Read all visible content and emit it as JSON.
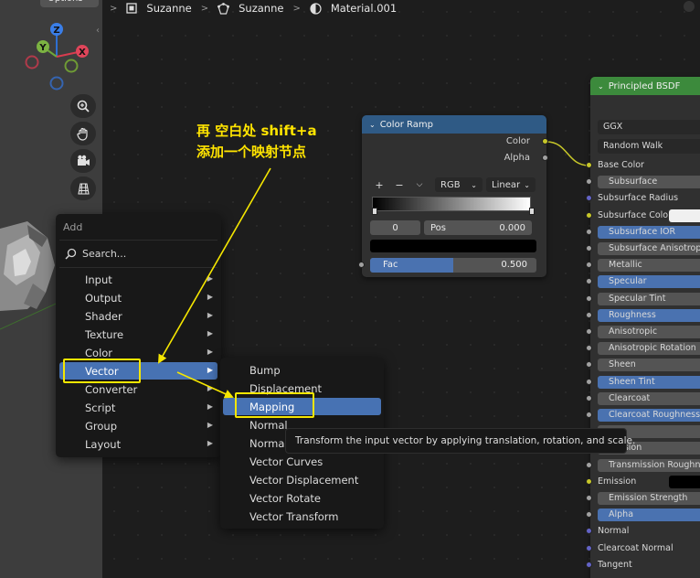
{
  "viewport": {
    "options_label": "Options",
    "gizmo_axes": [
      "Z",
      "Y",
      "X"
    ],
    "tools": [
      "zoom-icon",
      "hand-icon",
      "camera-icon",
      "grid-icon"
    ]
  },
  "breadcrumb": {
    "items": [
      {
        "label": "Suzanne",
        "icon": "object-icon"
      },
      {
        "label": "Suzanne",
        "icon": "mesh-icon"
      },
      {
        "label": "Material.001",
        "icon": "material-icon"
      }
    ]
  },
  "color_ramp": {
    "title": "Color Ramp",
    "outputs": [
      "Color",
      "Alpha"
    ],
    "tools": {
      "add": "+",
      "remove": "−",
      "more": "⌵"
    },
    "color_mode": "RGB",
    "interpolation": "Linear",
    "stop_index": "0",
    "pos_label": "Pos",
    "pos_value": "0.000",
    "fac_label": "Fac",
    "fac_value": "0.500",
    "fac_fraction": 0.5
  },
  "bsdf": {
    "title": "Principled BSDF",
    "distribution": "GGX",
    "subsurface_method": "Random Walk",
    "rows": [
      {
        "label": "Base Color",
        "kind": "socket",
        "socket": "#c7c729"
      },
      {
        "label": "Subsurface",
        "kind": "bar",
        "socket": "#a1a1a1"
      },
      {
        "label": "Subsurface Radius",
        "kind": "socket",
        "socket": "#6363c7"
      },
      {
        "label": "Subsurface Color",
        "kind": "socket-swatch",
        "socket": "#c7c729"
      },
      {
        "label": "Subsurface IOR",
        "kind": "bar-blue",
        "socket": "#a1a1a1"
      },
      {
        "label": "Subsurface Anisotropy",
        "kind": "bar",
        "socket": "#a1a1a1"
      },
      {
        "label": "Metallic",
        "kind": "bar",
        "socket": "#a1a1a1"
      },
      {
        "label": "Specular",
        "kind": "bar-blue",
        "socket": "#a1a1a1"
      },
      {
        "label": "Specular Tint",
        "kind": "bar",
        "socket": "#a1a1a1"
      },
      {
        "label": "Roughness",
        "kind": "bar-blue",
        "socket": "#a1a1a1"
      },
      {
        "label": "Anisotropic",
        "kind": "bar",
        "socket": "#a1a1a1"
      },
      {
        "label": "Anisotropic Rotation",
        "kind": "bar",
        "socket": "#a1a1a1"
      },
      {
        "label": "Sheen",
        "kind": "bar",
        "socket": "#a1a1a1"
      },
      {
        "label": "Sheen Tint",
        "kind": "bar-blue",
        "socket": "#a1a1a1"
      },
      {
        "label": "Clearcoat",
        "kind": "bar",
        "socket": "#a1a1a1"
      },
      {
        "label": "Clearcoat Roughness",
        "kind": "bar-blue",
        "socket": "#a1a1a1"
      },
      {
        "label": "",
        "kind": "bar",
        "socket": "#a1a1a1"
      },
      {
        "label": "mission",
        "kind": "bar",
        "socket": "#a1a1a1"
      },
      {
        "label": "Transmission Roughness",
        "kind": "bar",
        "socket": "#a1a1a1"
      },
      {
        "label": "Emission",
        "kind": "socket-swatch-black",
        "socket": "#c7c729"
      },
      {
        "label": "Emission Strength",
        "kind": "bar",
        "socket": "#a1a1a1"
      },
      {
        "label": "Alpha",
        "kind": "bar-blue",
        "socket": "#a1a1a1"
      },
      {
        "label": "Normal",
        "kind": "socket",
        "socket": "#6363c7"
      },
      {
        "label": "Clearcoat Normal",
        "kind": "socket",
        "socket": "#6363c7"
      },
      {
        "label": "Tangent",
        "kind": "socket",
        "socket": "#6363c7"
      }
    ]
  },
  "add_menu": {
    "title": "Add",
    "search_label": "Search...",
    "items": [
      {
        "label": "Input",
        "active": false
      },
      {
        "label": "Output",
        "active": false
      },
      {
        "label": "Shader",
        "active": false
      },
      {
        "label": "Texture",
        "active": false
      },
      {
        "label": "Color",
        "active": false
      },
      {
        "label": "Vector",
        "active": true
      },
      {
        "label": "Converter",
        "active": false
      },
      {
        "label": "Script",
        "active": false
      },
      {
        "label": "Group",
        "active": false
      },
      {
        "label": "Layout",
        "active": false
      }
    ]
  },
  "vector_menu": {
    "items": [
      {
        "label": "Bump",
        "active": false
      },
      {
        "label": "Displacement",
        "active": false
      },
      {
        "label": "Mapping",
        "active": true
      },
      {
        "label": "Normal",
        "active": false
      },
      {
        "label": "Normal",
        "active": false
      },
      {
        "label": "Vector Curves",
        "active": false
      },
      {
        "label": "Vector Displacement",
        "active": false
      },
      {
        "label": "Vector Rotate",
        "active": false
      },
      {
        "label": "Vector Transform",
        "active": false
      }
    ]
  },
  "tooltip": "Transform the input vector by applying translation, rotation, and scale.",
  "annotation": {
    "line1": "再 空白处 shift+a",
    "line2": "添加一个映射节点",
    "color": "#ffe400"
  },
  "colors": {
    "accent": "#4772b3",
    "bsdf_header": "#3c8a3c",
    "ramp_header": "#2f5a85"
  }
}
